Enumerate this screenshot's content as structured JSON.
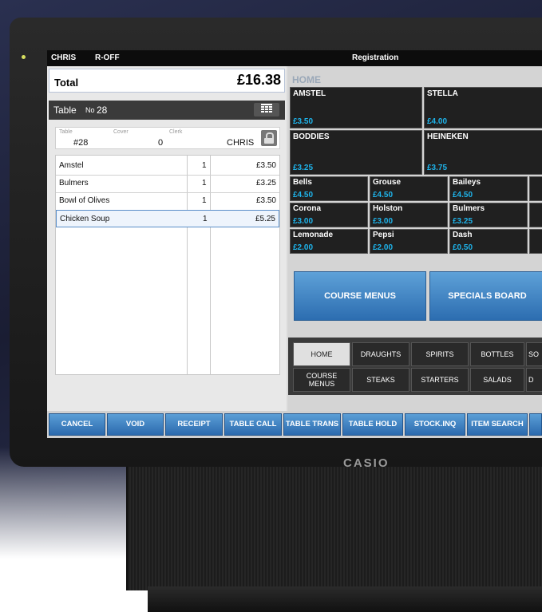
{
  "device": {
    "brand": "CASIO"
  },
  "status_bar": {
    "user": "CHRIS",
    "mode": "R-OFF",
    "title": "Registration"
  },
  "total": {
    "label": "Total",
    "amount": "£16.38"
  },
  "table_bar": {
    "label": "Table",
    "no_label": "No",
    "number": "28",
    "icon": "grid-icon"
  },
  "table_info": {
    "table_label": "Table",
    "table_value": "#28",
    "cover_label": "Cover",
    "cover_value": "0",
    "clerk_label": "Clerk",
    "clerk_value": "CHRIS",
    "lock_icon": "lock-icon"
  },
  "orders": [
    {
      "name": "Amstel",
      "qty": "1",
      "price": "£3.50"
    },
    {
      "name": "Bulmers",
      "qty": "1",
      "price": "£3.25"
    },
    {
      "name": "Bowl of Olives",
      "qty": "1",
      "price": "£3.50"
    },
    {
      "name": "Chicken Soup",
      "qty": "1",
      "price": "£5.25",
      "selected": true
    }
  ],
  "menu": {
    "breadcrumb": "HOME",
    "large_items": [
      {
        "name": "AMSTEL",
        "price": "£3.50"
      },
      {
        "name": "STELLA",
        "price": "£4.00"
      },
      {
        "name": "BODDIES",
        "price": "£3.25"
      },
      {
        "name": "HEINEKEN",
        "price": "£3.75"
      }
    ],
    "small_items": [
      {
        "name": "Bells",
        "price": "£4.50"
      },
      {
        "name": "Grouse",
        "price": "£4.50"
      },
      {
        "name": "Baileys",
        "price": "£4.50"
      },
      {
        "name": "Corona",
        "price": "£3.00"
      },
      {
        "name": "Holston",
        "price": "£3.00"
      },
      {
        "name": "Bulmers",
        "price": "£3.25"
      },
      {
        "name": "Lemonade",
        "price": "£2.00"
      },
      {
        "name": "Pepsi",
        "price": "£2.00"
      },
      {
        "name": "Dash",
        "price": "£0.50"
      }
    ],
    "course_menus": "COURSE MENUS",
    "specials_board": "SPECIALS BOARD"
  },
  "category_tabs": {
    "row1": [
      "HOME",
      "DRAUGHTS",
      "SPIRITS",
      "BOTTLES",
      "SO"
    ],
    "row2": [
      "COURSE MENUS",
      "STEAKS",
      "STARTERS",
      "SALADS",
      "D"
    ],
    "active": "HOME"
  },
  "bottom_buttons": [
    "CANCEL",
    "VOID",
    "RECEIPT",
    "TABLE CALL",
    "TABLE TRANS",
    "TABLE HOLD",
    "STOCK.INQ",
    "ITEM SEARCH"
  ]
}
